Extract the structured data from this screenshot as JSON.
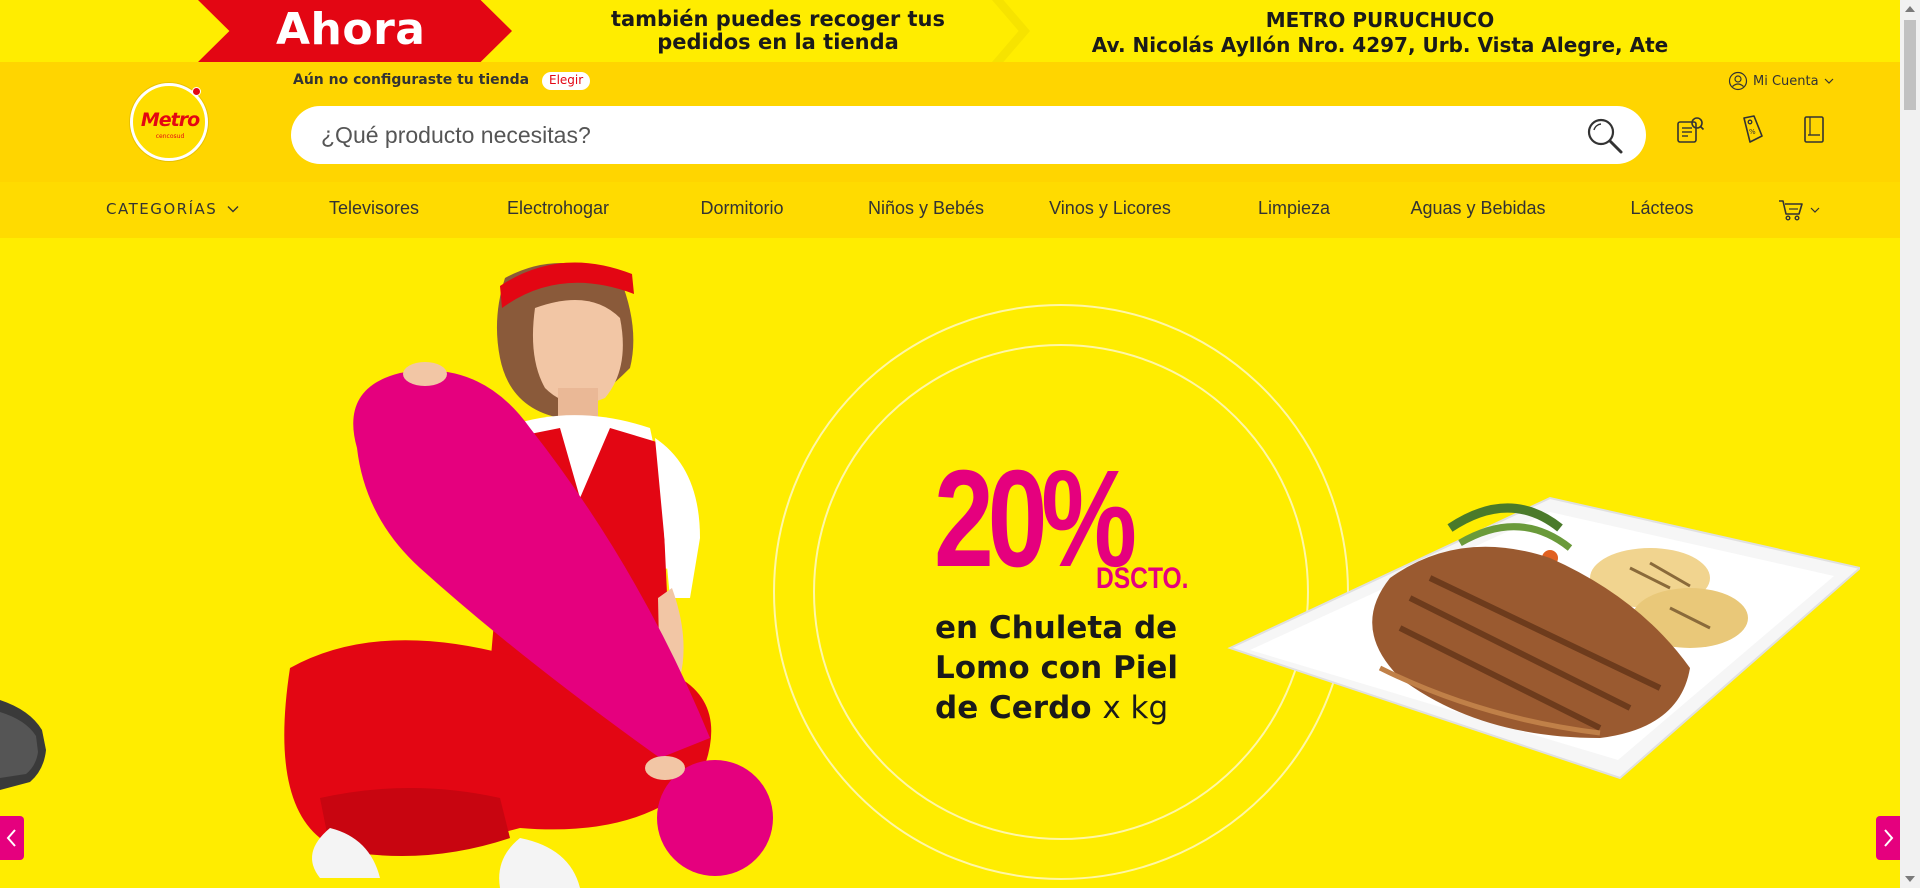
{
  "promo": {
    "ahora": "Ahora",
    "line1": "también puedes recoger tus",
    "line2": "pedidos en la tienda",
    "store_name": "METRO PURUCHUCO",
    "store_address": "Av. Nicolás Ayllón Nro. 4297, Urb. Vista Alegre, Ate"
  },
  "header": {
    "logo_text": "Metro",
    "logo_sub": "cencosud",
    "store_prompt": "Aún no configuraste tu tienda",
    "store_pick": "Elegir",
    "search_placeholder": "¿Qué producto necesitas?",
    "account_label": "Mi Cuenta",
    "icons": [
      "orders-icon",
      "offers-tag-icon",
      "catalog-icon"
    ]
  },
  "nav": {
    "categories_label": "CATEGORÍAS",
    "items": [
      "Televisores",
      "Electrohogar",
      "Dormitorio",
      "Niños y Bebés",
      "Vinos y Licores",
      "Limpieza",
      "Aguas y Bebidas",
      "Lácteos"
    ]
  },
  "banner": {
    "percent": "20%",
    "dscto": "DSCTO.",
    "offer_line1": "en Chuleta de",
    "offer_line2": "Lomo con Piel",
    "offer_line3": "de Cerdo",
    "offer_unit": "x kg"
  },
  "colors": {
    "yellow": "#ffed00",
    "header_yellow": "#ffd500",
    "magenta": "#e5007e",
    "red": "#e30613"
  }
}
